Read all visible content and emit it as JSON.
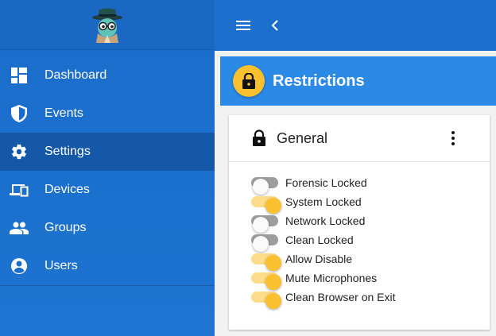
{
  "colors": {
    "sidebar": "#1a6cca",
    "sidebar_active": "#1558a8",
    "topbar": "#1d6fce",
    "header": "#2a8ae6",
    "accent": "#fbc02d"
  },
  "logo": {
    "icon": "spy-mascot-logo"
  },
  "topbar": {
    "menu_icon": "hamburger-icon",
    "back_icon": "chevron-left-icon"
  },
  "sidebar": {
    "items": [
      {
        "label": "Dashboard",
        "icon": "dashboard-icon"
      },
      {
        "label": "Events",
        "icon": "shield-icon"
      },
      {
        "label": "Settings",
        "icon": "gear-icon",
        "active": true
      },
      {
        "label": "Devices",
        "icon": "devices-icon"
      },
      {
        "label": "Groups",
        "icon": "group-icon"
      },
      {
        "label": "Users",
        "icon": "account-circle-icon"
      }
    ]
  },
  "section": {
    "title": "Restrictions",
    "icon": "lock-icon"
  },
  "card": {
    "title": "General",
    "icon": "lock-icon",
    "more_icon": "more-vert-icon",
    "toggles": [
      {
        "label": "Forensic Locked",
        "on": false
      },
      {
        "label": "System Locked",
        "on": true
      },
      {
        "label": "Network Locked",
        "on": false
      },
      {
        "label": "Clean Locked",
        "on": false
      },
      {
        "label": "Allow Disable",
        "on": true
      },
      {
        "label": "Mute Microphones",
        "on": true
      },
      {
        "label": "Clean Browser on Exit",
        "on": true
      }
    ]
  }
}
